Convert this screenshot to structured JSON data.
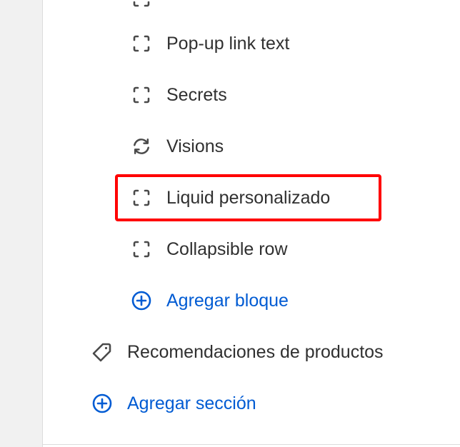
{
  "blocks": [
    {
      "label": "Pop-up link text",
      "icon": "dashed-square-icon"
    },
    {
      "label": "Secrets",
      "icon": "dashed-square-icon"
    },
    {
      "label": "Visions",
      "icon": "refresh-icon"
    },
    {
      "label": "Liquid personalizado",
      "icon": "dashed-square-icon"
    },
    {
      "label": "Collapsible row",
      "icon": "dashed-square-icon"
    }
  ],
  "add_block_label": "Agregar bloque",
  "section_label": "Recomendaciones de productos",
  "add_section_label": "Agregar sección",
  "colors": {
    "accent": "#005bd3",
    "text": "#303030",
    "highlight": "#ff0000"
  }
}
